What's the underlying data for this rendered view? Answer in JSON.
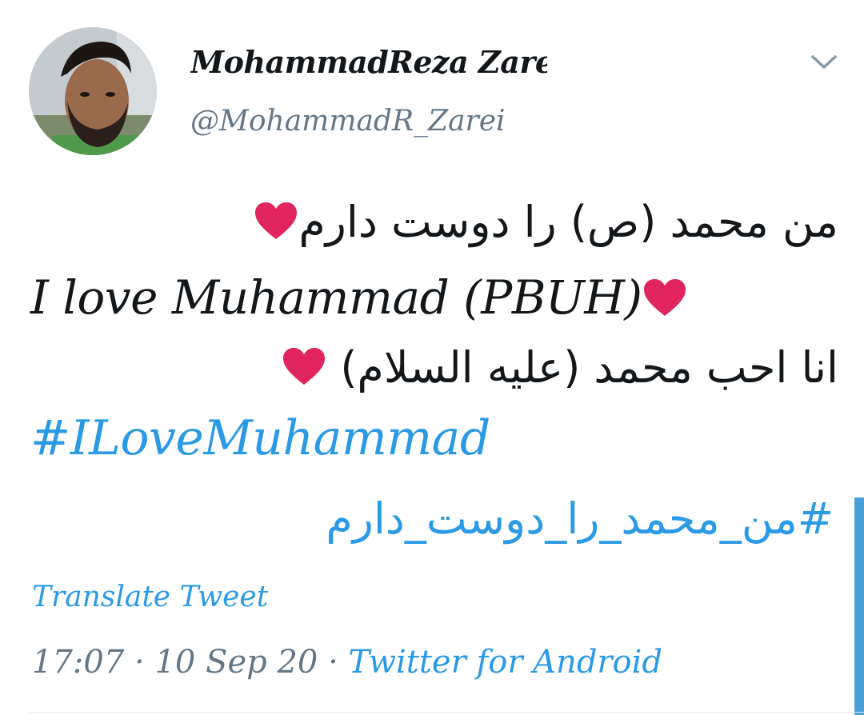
{
  "tweet": {
    "author": {
      "display_name": "MohammadReza Zarei",
      "handle": "@MohammadR_Zarei"
    },
    "lines": {
      "persian": "من محمد (ص) را دوست دارم",
      "english": "I love Muhammad (PBUH)",
      "arabic": "انا احب محمد (عليه السلام)"
    },
    "hashtags": {
      "english": "#ILoveMuhammad",
      "persian": "#من_محمد_را_دوست_دارم"
    },
    "translate_label": "Translate Tweet",
    "meta": {
      "time": "17:07",
      "separator": "·",
      "date": "10 Sep 20",
      "source": "Twitter for Android"
    }
  },
  "colors": {
    "text": "#14171a",
    "secondary": "#657786",
    "link": "#2b9ae4",
    "heart": "#e0245e"
  },
  "icons": {
    "caret": "chevron-down-icon",
    "heart": "red-heart-emoji"
  }
}
